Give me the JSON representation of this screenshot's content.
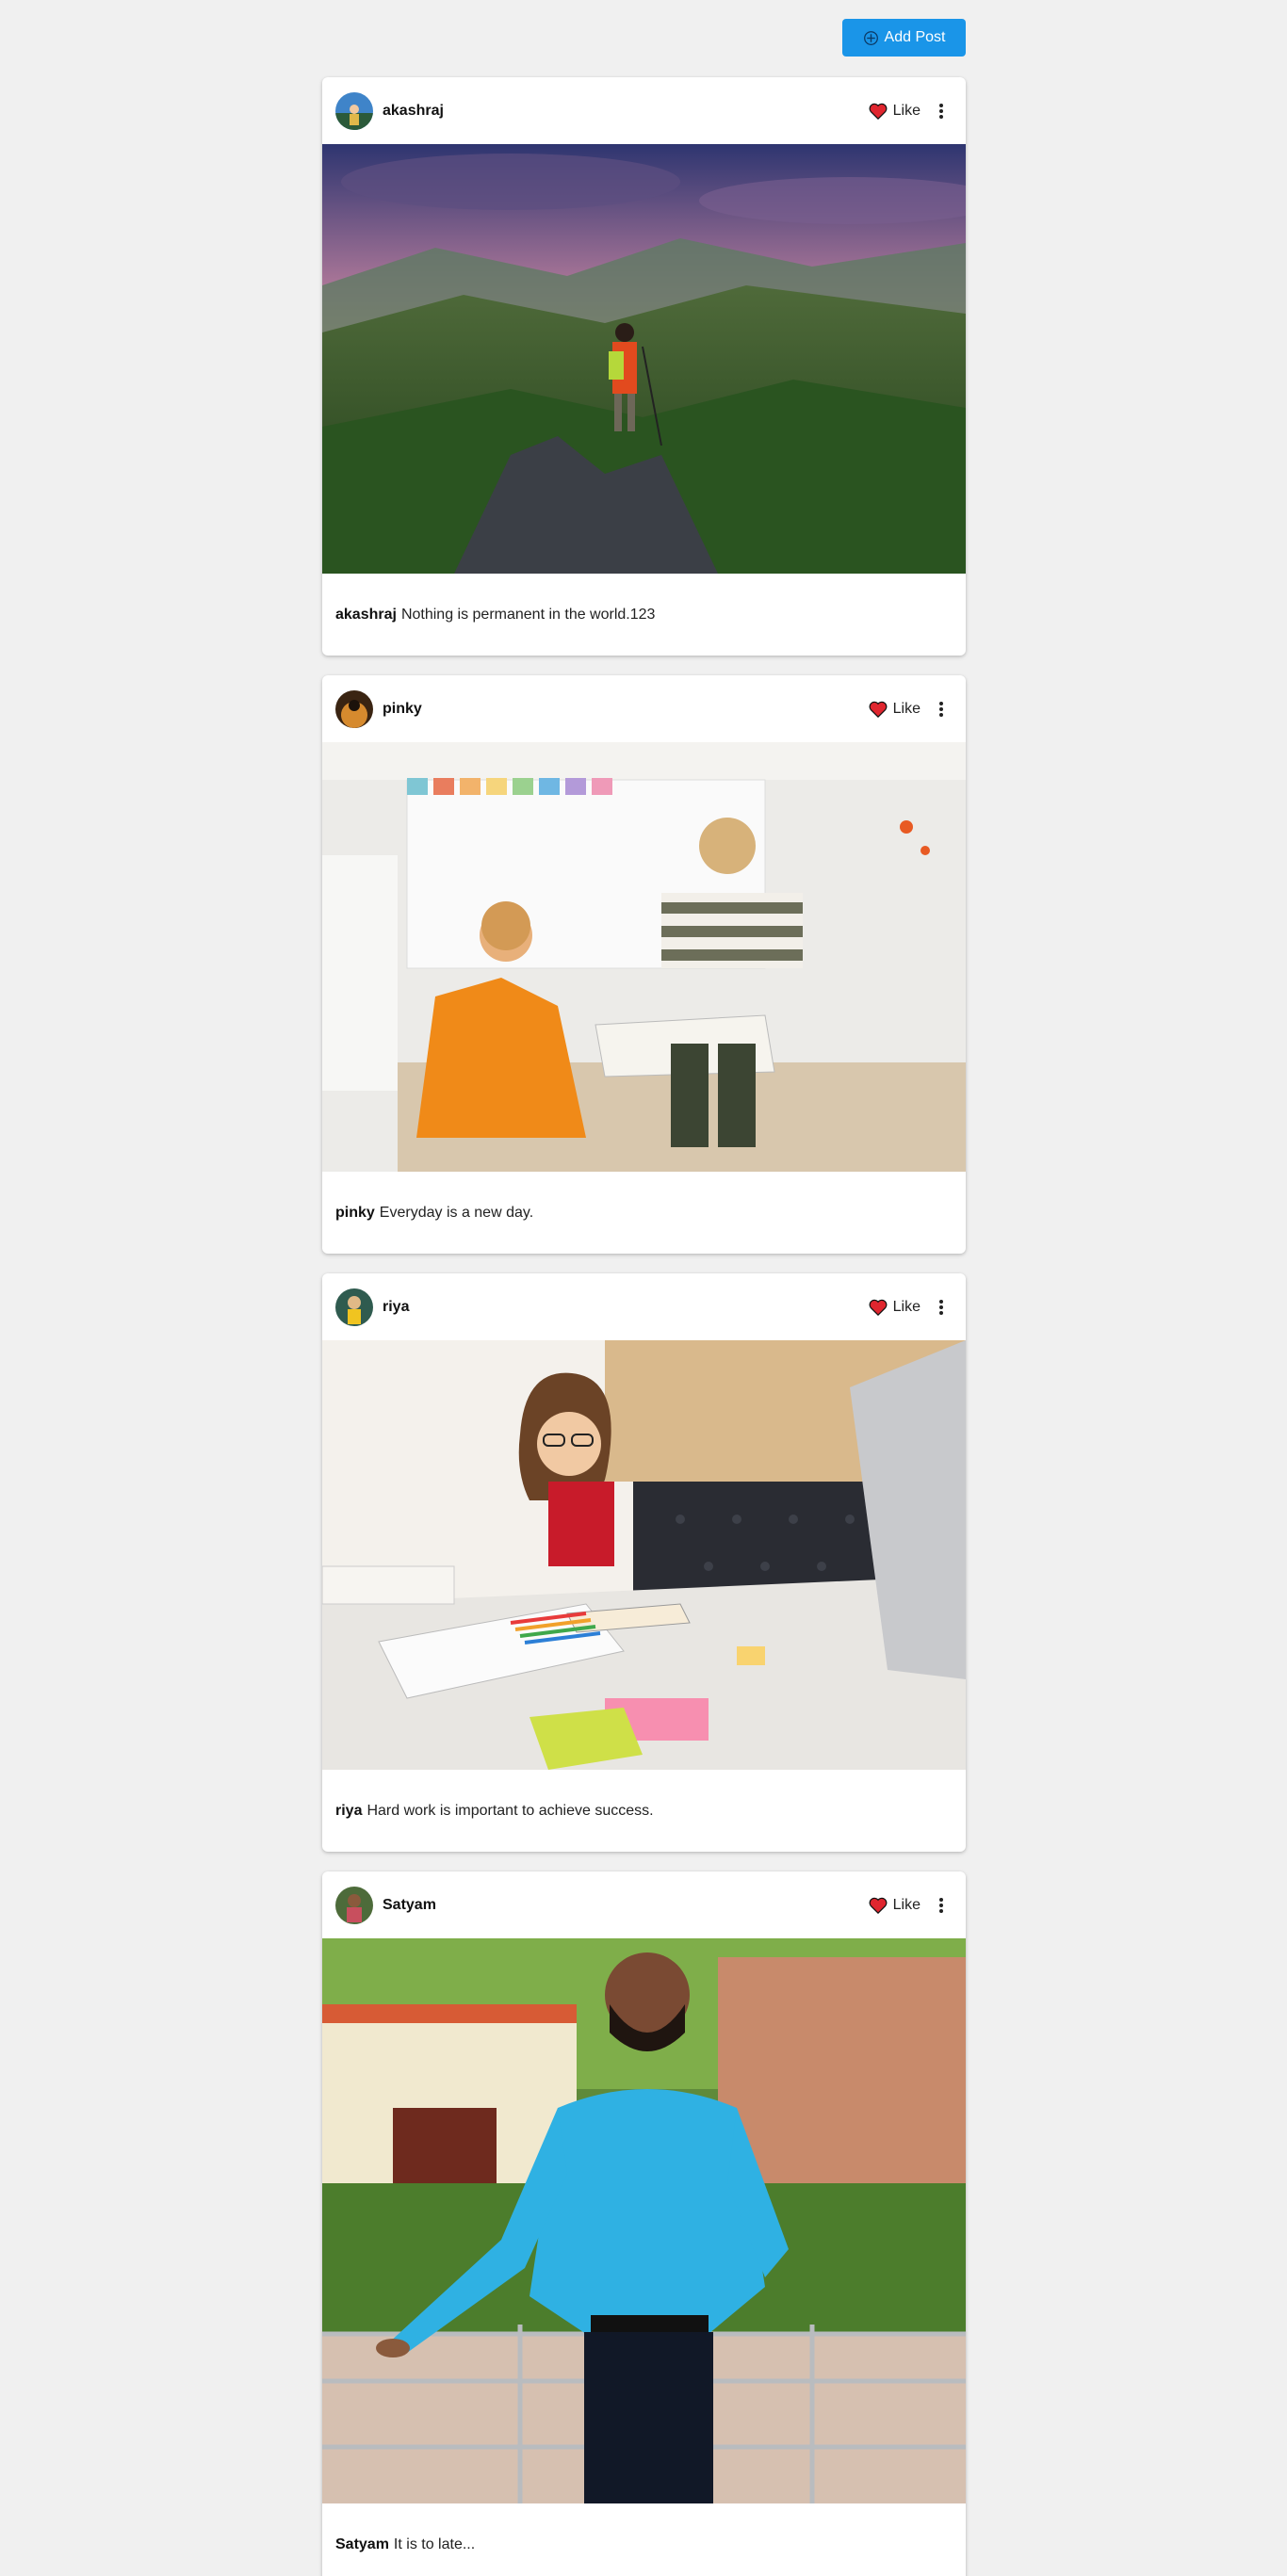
{
  "toolbar": {
    "add_post_label": "Add Post",
    "accent_color": "#1a95e8"
  },
  "icons": {
    "add": "plus-circle-icon",
    "like": "heart-icon",
    "more": "kebab-menu-icon"
  },
  "like_color": "#e0262f",
  "posts": [
    {
      "username": "akashraj",
      "like_label": "Like",
      "caption_user": "akashraj",
      "caption_text": "Nothing is permanent in the world.123"
    },
    {
      "username": "pinky",
      "like_label": "Like",
      "caption_user": "pinky",
      "caption_text": "Everyday is a new day."
    },
    {
      "username": "riya",
      "like_label": "Like",
      "caption_user": "riya",
      "caption_text": "Hard work is important to achieve success."
    },
    {
      "username": "Satyam",
      "like_label": "Like",
      "caption_user": "Satyam",
      "caption_text": "It is to late..."
    }
  ]
}
